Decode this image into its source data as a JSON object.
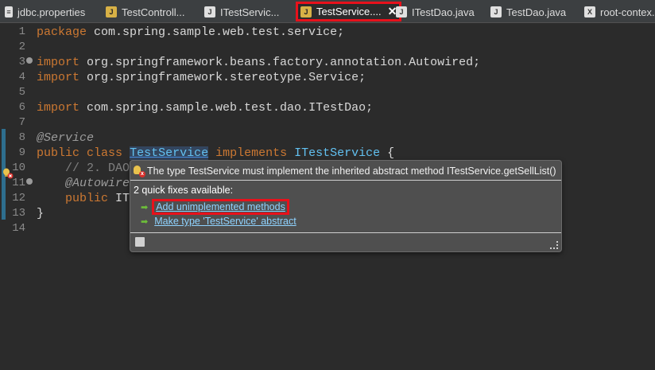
{
  "tabs": [
    {
      "label": "jdbc.properties",
      "icon": "file-icon"
    },
    {
      "label": "TestControll...",
      "icon": "java-class-icon"
    },
    {
      "label": "ITestServic...",
      "icon": "java-interface-icon"
    },
    {
      "label": "TestService....",
      "icon": "java-class-icon",
      "active": true,
      "close": "✕"
    },
    {
      "label": "ITestDao.java",
      "icon": "java-interface-icon"
    },
    {
      "label": "TestDao.java",
      "icon": "java-interface-icon"
    },
    {
      "label": "root-contex...",
      "icon": "xml-file-icon"
    }
  ],
  "editor": {
    "line_numbers": [
      "1",
      "2",
      "3",
      "4",
      "5",
      "6",
      "7",
      "8",
      "9",
      "10",
      "11",
      "12",
      "13",
      "14"
    ],
    "lines": {
      "l1_kw": "package",
      "l1_rest": " com.spring.sample.web.test.service;",
      "l3_kw": "import",
      "l3_rest": " org.springframework.beans.factory.annotation.Autowired;",
      "l4_kw": "import",
      "l4_rest": " org.springframework.stereotype.Service;",
      "l6_kw": "import",
      "l6_rest": " com.spring.sample.web.test.dao.ITestDao;",
      "l8_ann": "@Service",
      "l9_kw1": "public",
      "l9_kw2": "class",
      "l9_sel": "TestService",
      "l9_kw3": "implements",
      "l9_type": "ITestService",
      "l9_brace": " {",
      "l10": "    // 2. DAO",
      "l11": "    @Autowire",
      "l12_kw": "public",
      "l12_rest": " IT",
      "l13": "}"
    }
  },
  "popup": {
    "message": "The type TestService must implement the inherited abstract method ITestService.getSellList()",
    "fix_count": "2 quick fixes available:",
    "fixes": [
      {
        "label": "Add unimplemented methods"
      },
      {
        "label": "Make type 'TestService' abstract"
      }
    ]
  },
  "colors": {
    "highlight": "#e8111b",
    "keyword": "#cc7832",
    "link": "#8fd3ff"
  }
}
